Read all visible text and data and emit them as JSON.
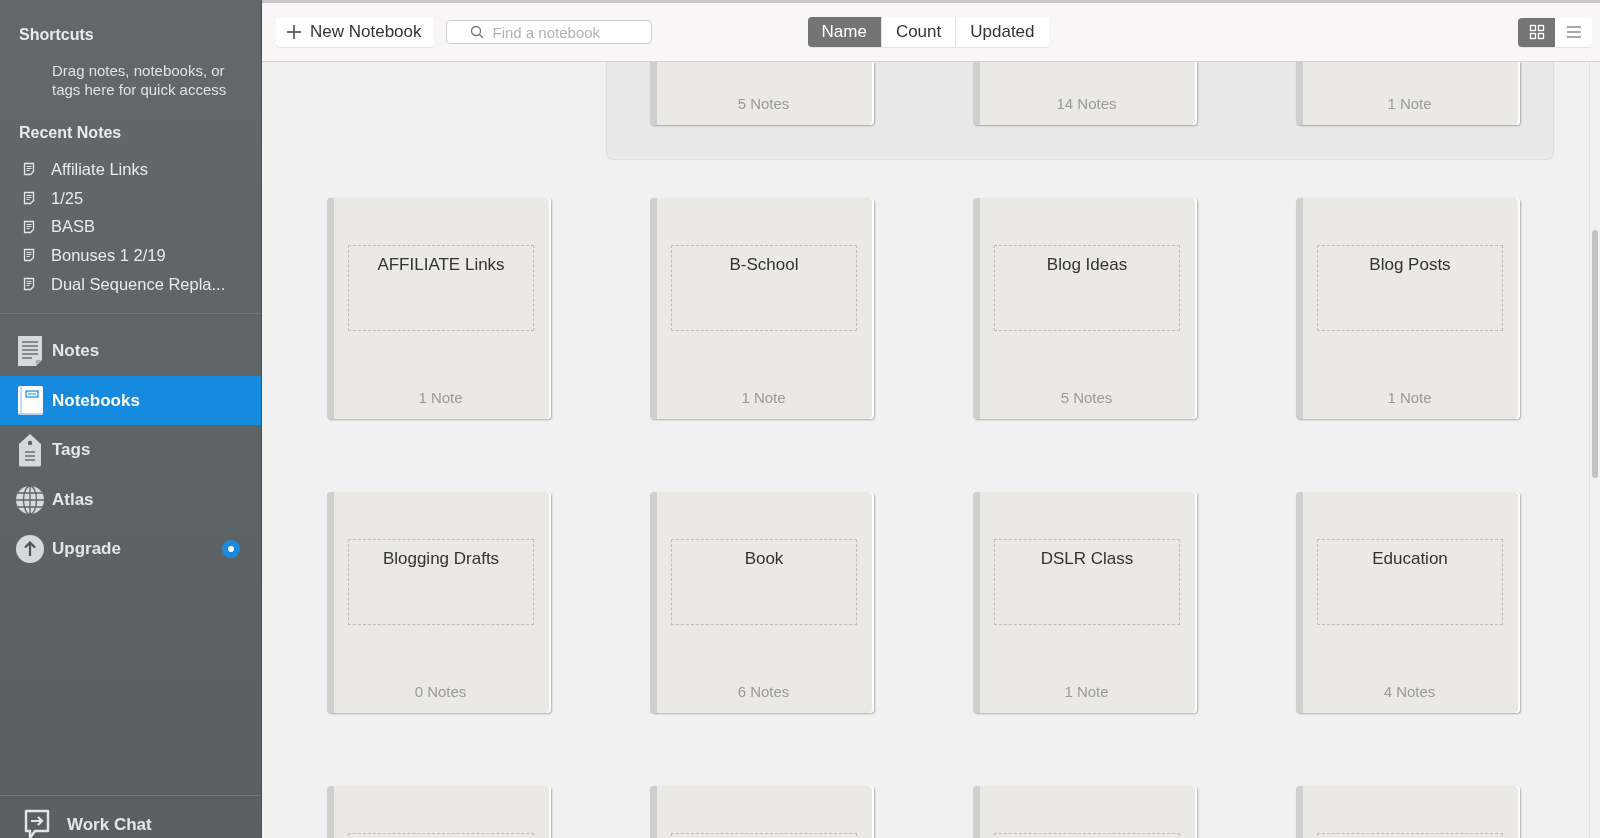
{
  "sidebar": {
    "shortcuts": {
      "title": "Shortcuts",
      "hint": "Drag notes, notebooks, or tags here for quick access"
    },
    "recent_notes": {
      "title": "Recent Notes",
      "items": [
        "Affiliate Links",
        "1/25",
        "BASB",
        "Bonuses 1 2/19",
        "Dual Sequence Repla..."
      ]
    },
    "nav": [
      {
        "label": "Notes",
        "kind": "notes",
        "selected": false,
        "badge": false
      },
      {
        "label": "Notebooks",
        "kind": "notebooks",
        "selected": true,
        "badge": false
      },
      {
        "label": "Tags",
        "kind": "tags",
        "selected": false,
        "badge": false
      },
      {
        "label": "Atlas",
        "kind": "atlas",
        "selected": false,
        "badge": false
      },
      {
        "label": "Upgrade",
        "kind": "upgrade",
        "selected": false,
        "badge": true
      }
    ],
    "footer": {
      "label": "Work Chat"
    }
  },
  "toolbar": {
    "new_button": "New Notebook",
    "search": {
      "placeholder": "Find a notebook"
    },
    "sort_options": [
      {
        "label": "Name",
        "selected": true
      },
      {
        "label": "Count",
        "selected": false
      },
      {
        "label": "Updated",
        "selected": false
      }
    ],
    "view_modes": [
      {
        "kind": "grid",
        "selected": true
      },
      {
        "kind": "list",
        "selected": false
      }
    ]
  },
  "stack": {
    "notebooks": [
      {
        "count": "5 Notes"
      },
      {
        "count": "14 Notes"
      },
      {
        "count": "1 Note"
      }
    ]
  },
  "notebooks": [
    {
      "name": "AFFILIATE Links",
      "count": "1 Note"
    },
    {
      "name": "B-School",
      "count": "1 Note"
    },
    {
      "name": "Blog Ideas",
      "count": "5 Notes"
    },
    {
      "name": "Blog Posts",
      "count": "1 Note"
    },
    {
      "name": "Blogging Drafts",
      "count": "0 Notes"
    },
    {
      "name": "Book",
      "count": "6 Notes"
    },
    {
      "name": "DSLR Class",
      "count": "1 Note"
    },
    {
      "name": "Education",
      "count": "4 Notes"
    }
  ]
}
